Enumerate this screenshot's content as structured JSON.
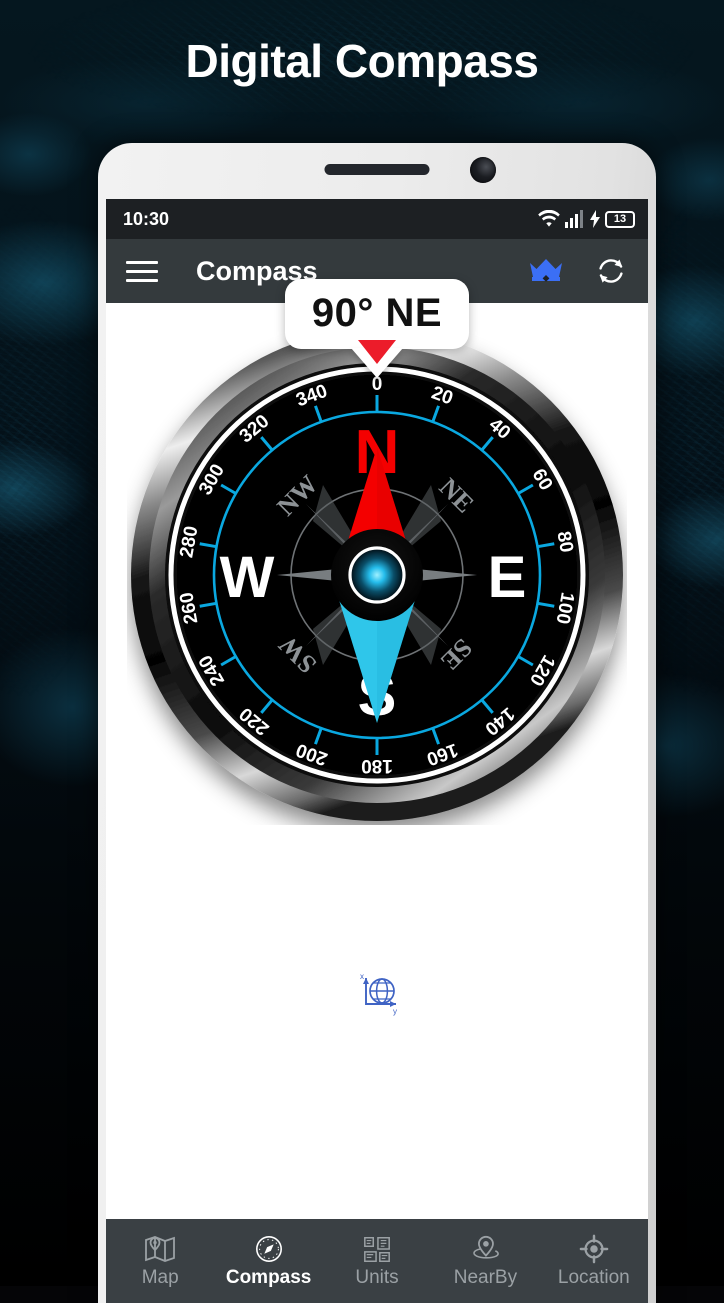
{
  "banner": {
    "headline": "Digital Compass"
  },
  "statusbar": {
    "time": "10:30",
    "battery_level": "13",
    "icons": [
      "wifi-icon",
      "cellular-signal-icon",
      "charging-bolt-icon",
      "battery-icon"
    ]
  },
  "appbar": {
    "title": "Compass",
    "menu_icon": "hamburger-menu-icon",
    "premium_icon": "crown-icon",
    "premium_color": "#3b6ff5",
    "refresh_icon": "refresh-icon"
  },
  "heading_bubble": {
    "degrees": "90",
    "degree_symbol": "°",
    "direction": "NE",
    "text": "90° NE",
    "pointer_color": "#ec1c2a"
  },
  "compass": {
    "heading_degrees": 90,
    "needle_north_color": "#f40000",
    "needle_south_color": "#2fc6ea",
    "dial_ring_color": "#0aa8e0",
    "face_color": "#000000",
    "cardinal_labels": [
      "N",
      "E",
      "S",
      "W"
    ],
    "north_label_color": "#f40000",
    "intercardinal_labels": [
      "NW",
      "NE",
      "SE",
      "SW"
    ],
    "degree_ticks": [
      "0",
      "20",
      "40",
      "60",
      "80",
      "100",
      "120",
      "140",
      "160",
      "180",
      "200",
      "220",
      "240",
      "260",
      "280",
      "300",
      "320",
      "340"
    ],
    "tick_interval_degrees": 20,
    "center_dot_color": "#13b9e8"
  },
  "globe": {
    "icon": "globe-axes-icon",
    "color": "#3f63c4",
    "axis_x": "x",
    "axis_y": "y"
  },
  "bottomnav": {
    "items": [
      {
        "label": "Map",
        "icon": "map-icon",
        "active": false
      },
      {
        "label": "Compass",
        "icon": "compass-icon",
        "active": true
      },
      {
        "label": "Units",
        "icon": "units-icon",
        "active": false
      },
      {
        "label": "NearBy",
        "icon": "nearby-pin-icon",
        "active": false
      },
      {
        "label": "Location",
        "icon": "location-target-icon",
        "active": false
      }
    ]
  }
}
